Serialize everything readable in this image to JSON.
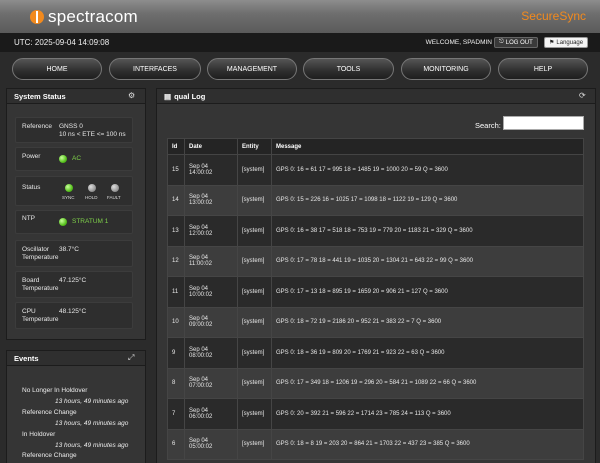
{
  "header": {
    "brand": "spectracom",
    "product": "SecureSync"
  },
  "infobar": {
    "utc": "UTC: 2025-09-04 14:09:08",
    "welcome": "WELCOME, SPADMIN",
    "logout": "LOG OUT",
    "language": "Language"
  },
  "nav": [
    "HOME",
    "INTERFACES",
    "MANAGEMENT",
    "TOOLS",
    "MONITORING",
    "HELP"
  ],
  "system_status": {
    "title": "System Status",
    "reference": {
      "label": "Reference",
      "value1": "GNSS 0",
      "value2": "10 ns < ETE <= 100 ns"
    },
    "power": {
      "label": "Power",
      "value": "AC"
    },
    "status": {
      "label": "Status",
      "sync": "SYNC",
      "hold": "HOLD",
      "fault": "FAULT"
    },
    "ntp": {
      "label": "NTP",
      "value": "STRATUM 1"
    },
    "oscillator": {
      "label1": "Oscillator",
      "label2": "Temperature",
      "value": "38.7°C"
    },
    "board": {
      "label1": "Board",
      "label2": "Temperature",
      "value": "47.125°C"
    },
    "cpu": {
      "label1": "CPU",
      "label2": "Temperature",
      "value": "48.125°C"
    }
  },
  "events": {
    "title": "Events",
    "items": [
      {
        "name": "No Longer In Holdover",
        "time": "13 hours, 49 minutes ago"
      },
      {
        "name": "Reference Change",
        "time": "13 hours, 49 minutes ago"
      },
      {
        "name": "In Holdover",
        "time": "13 hours, 49 minutes ago"
      },
      {
        "name": "Reference Change",
        "time": ""
      }
    ]
  },
  "log": {
    "title": "qual Log",
    "search_label": "Search:",
    "columns": [
      "Id",
      "Date",
      "Entity",
      "Message"
    ],
    "rows": [
      {
        "id": "15",
        "date1": "Sep 04",
        "date2": "14:00:02",
        "entity": "[system]",
        "message": "GPS 0: 16 = 61 17 = 995 18 = 1485 19 = 1000 20 = 59 Q = 3600"
      },
      {
        "id": "14",
        "date1": "Sep 04",
        "date2": "13:00:02",
        "entity": "[system]",
        "message": "GPS 0: 15 = 226 16 = 1025 17 = 1098 18 = 1122 19 = 129 Q = 3600"
      },
      {
        "id": "13",
        "date1": "Sep 04",
        "date2": "12:00:02",
        "entity": "[system]",
        "message": "GPS 0: 16 = 38 17 = 518 18 = 753 19 = 779 20 = 1183 21 = 329 Q = 3600"
      },
      {
        "id": "12",
        "date1": "Sep 04",
        "date2": "11:00:02",
        "entity": "[system]",
        "message": "GPS 0: 17 = 78 18 = 441 19 = 1035 20 = 1304 21 = 643 22 = 99 Q = 3600"
      },
      {
        "id": "11",
        "date1": "Sep 04",
        "date2": "10:00:02",
        "entity": "[system]",
        "message": "GPS 0: 17 = 13 18 = 895 19 = 1659 20 = 906 21 = 127 Q = 3600"
      },
      {
        "id": "10",
        "date1": "Sep 04",
        "date2": "09:00:02",
        "entity": "[system]",
        "message": "GPS 0: 18 = 72 19 = 2186 20 = 952 21 = 383 22 = 7 Q = 3600"
      },
      {
        "id": "9",
        "date1": "Sep 04",
        "date2": "08:00:02",
        "entity": "[system]",
        "message": "GPS 0: 18 = 36 19 = 809 20 = 1769 21 = 923 22 = 63 Q = 3600"
      },
      {
        "id": "8",
        "date1": "Sep 04",
        "date2": "07:00:02",
        "entity": "[system]",
        "message": "GPS 0: 17 = 349 18 = 1206 19 = 296 20 = 584 21 = 1089 22 = 66 Q = 3600"
      },
      {
        "id": "7",
        "date1": "Sep 04",
        "date2": "06:00:02",
        "entity": "[system]",
        "message": "GPS 0: 20 = 392 21 = 596 22 = 1714 23 = 785 24 = 113 Q = 3600"
      },
      {
        "id": "6",
        "date1": "Sep 04",
        "date2": "05:00:02",
        "entity": "[system]",
        "message": "GPS 0: 18 = 8 19 = 203 20 = 864 21 = 1703 22 = 437 23 = 385 Q = 3600"
      }
    ]
  },
  "colors": {
    "accent": "#f28a1e",
    "led_green": "#58c21e",
    "ok_text": "#7fd14a"
  }
}
